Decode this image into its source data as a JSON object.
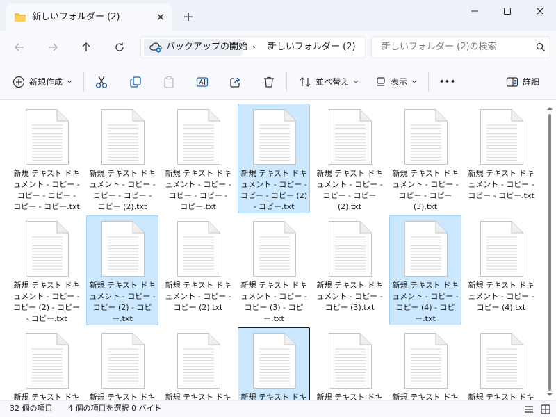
{
  "window": {
    "tab_title": "新しいフォルダー (2)",
    "tab_close": "✕",
    "new_tab": "+"
  },
  "address": {
    "root": "バックアップの開始",
    "separator": "›",
    "folder": "新しいフォルダー (2)"
  },
  "search": {
    "placeholder": "新しいフォルダー (2)の検索"
  },
  "toolbar": {
    "new_label": "新規作成",
    "sort_label": "並べ替え",
    "view_label": "表示",
    "more_label": "•••",
    "details_label": "詳細"
  },
  "files": [
    {
      "name": "新規 テキスト ドキュメント - コピー - コピー - コピー - コピー - コピー.txt",
      "selected": false,
      "focused": false
    },
    {
      "name": "新規 テキスト ドキュメント - コピー - コピー - コピー - コピー (2).txt",
      "selected": false,
      "focused": false
    },
    {
      "name": "新規 テキスト ドキュメント - コピー - コピー - コピー - コピー.txt",
      "selected": false,
      "focused": false
    },
    {
      "name": "新規 テキスト ドキュメント - コピー - コピー - コピー (2) - コピー.txt",
      "selected": true,
      "focused": false
    },
    {
      "name": "新規 テキスト ドキュメント - コピー - コピー - コピー (2).txt",
      "selected": false,
      "focused": false
    },
    {
      "name": "新規 テキスト ドキュメント - コピー - コピー - コピー (3).txt",
      "selected": false,
      "focused": false
    },
    {
      "name": "新規 テキスト ドキュメント - コピー - コピー - コピー.txt",
      "selected": false,
      "focused": false
    },
    {
      "name": "新規 テキスト ドキュメント - コピー - コピー (2) - コピー - コピー.txt",
      "selected": false,
      "focused": false
    },
    {
      "name": "新規 テキスト ドキュメント - コピー - コピー (2) - コピー.txt",
      "selected": true,
      "focused": false
    },
    {
      "name": "新規 テキスト ドキュメント - コピー - コピー (2).txt",
      "selected": false,
      "focused": false
    },
    {
      "name": "新規 テキスト ドキュメント - コピー - コピー (3) - コピー.txt",
      "selected": false,
      "focused": false
    },
    {
      "name": "新規 テキスト ドキュメント - コピー - コピー (3).txt",
      "selected": false,
      "focused": false
    },
    {
      "name": "新規 テキスト ドキュメント - コピー - コピー (4) - コピー.txt",
      "selected": true,
      "focused": false
    },
    {
      "name": "新規 テキスト ドキュメント - コピー - コピー (4).txt",
      "selected": false,
      "focused": false
    },
    {
      "name": "新規 テキスト ドキュメント",
      "selected": false,
      "focused": false
    },
    {
      "name": "新規 テキスト ドキュメント",
      "selected": false,
      "focused": false
    },
    {
      "name": "新規 テキスト ドキュメント",
      "selected": false,
      "focused": false
    },
    {
      "name": "新規 テキスト ドキュメント",
      "selected": true,
      "focused": true
    },
    {
      "name": "新規 テキスト ドキュメント",
      "selected": false,
      "focused": false
    },
    {
      "name": "新規 テキスト ドキュメント",
      "selected": false,
      "focused": false
    },
    {
      "name": "新規 テキスト ドキュメント",
      "selected": false,
      "focused": false
    }
  ],
  "status": {
    "item_count": "32 個の項目",
    "selection": "4 個の項目を選択  0 バイト"
  },
  "colors": {
    "selected_bg": "#cce8ff",
    "selected_border": "#99d1ff",
    "folder_yellow": "#f5c342",
    "accent_blue": "#0067c0"
  }
}
